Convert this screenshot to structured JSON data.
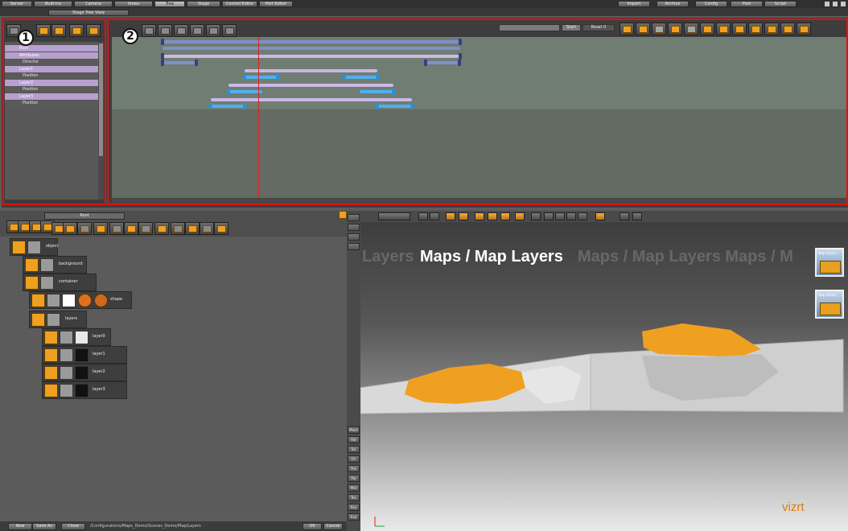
{
  "top_menu": {
    "items": [
      "Server",
      "Built-ins",
      "Camera",
      "Views",
      "Tree",
      "Stage",
      "Control Editor",
      "Port Editor"
    ],
    "active_index": 4,
    "right_items": [
      "Import",
      "Archive",
      "Config",
      "Post",
      "Script"
    ]
  },
  "stage_tab": "Stage Tree View",
  "callouts": {
    "one": "1",
    "two": "2"
  },
  "stage_tree": {
    "rows": [
      {
        "label": "Root",
        "style": "purple"
      },
      {
        "label": "Attributes",
        "style": "purple"
      },
      {
        "label": "Director",
        "style": "sub"
      },
      {
        "label": "Layer1",
        "style": "purple"
      },
      {
        "label": "Position",
        "style": "sub"
      },
      {
        "label": "Layer2",
        "style": "purple"
      },
      {
        "label": "Position",
        "style": "sub"
      },
      {
        "label": "Layer3",
        "style": "purple"
      },
      {
        "label": "Position",
        "style": "sub"
      }
    ]
  },
  "timeline": {
    "fields": [
      "Start",
      "Reset 0"
    ]
  },
  "scene_tree": {
    "dropdown_value": "Root",
    "nodes": [
      {
        "label": "object"
      },
      {
        "label": "background"
      },
      {
        "label": "container"
      },
      {
        "label": "shape"
      },
      {
        "label": "layers"
      },
      {
        "label": "layer0"
      },
      {
        "label": "layer1"
      },
      {
        "label": "layer2"
      },
      {
        "label": "layer3"
      }
    ]
  },
  "vertical_buttons": [
    "Move",
    "Rot",
    "Scl",
    "Ctr",
    "Pos",
    "Alp",
    "Mat",
    "Tex",
    "Key",
    "Exp"
  ],
  "bottom_bar": {
    "buttons": [
      "New",
      "Save As",
      "Close"
    ],
    "path": "/Configurations/Maps_Demo/Scenes_Demo/Map/Layers",
    "right_buttons": [
      "OK",
      "Cancel"
    ]
  },
  "render": {
    "title": "Maps / Map Layers",
    "ghost_text": "Maps / Map Layers Maps / M",
    "ghost_left": "Layers",
    "thumb1_label": "Map Layers",
    "thumb2_label": "Map Vector",
    "logo": "vizrt"
  },
  "colors": {
    "highlight_red": "#e01010",
    "accent_orange": "#f0a020",
    "track_purple": "#cbb8e6",
    "track_blue": "#7f90c8",
    "key_cyan": "#4fb0ee"
  }
}
